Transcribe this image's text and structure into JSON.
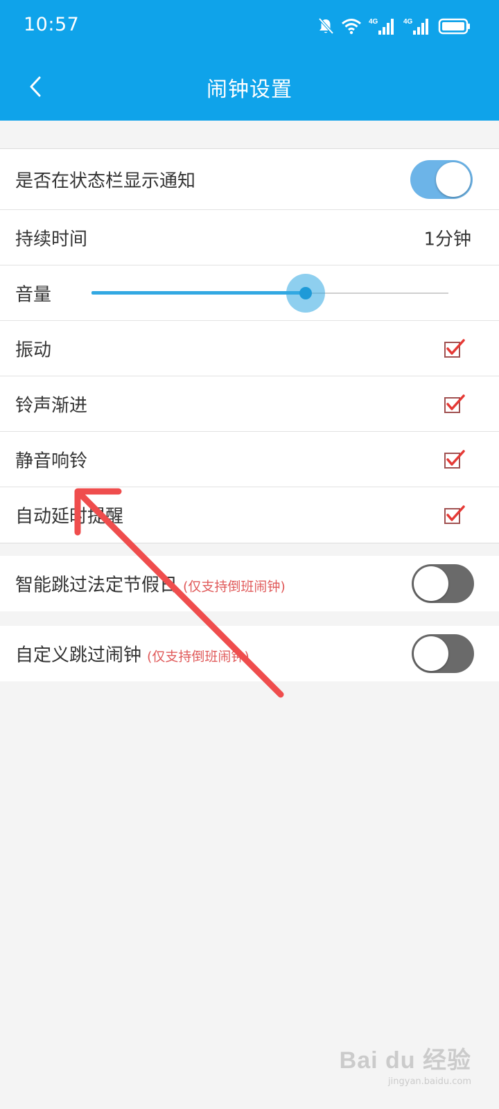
{
  "status_bar": {
    "time": "10:57",
    "icons": [
      "bell-muted-icon",
      "wifi-icon",
      "signal-4g-icon",
      "signal-4g-icon",
      "battery-icon"
    ],
    "network_label": "4G"
  },
  "header": {
    "title": "闹钟设置",
    "back_icon": "chevron-left-icon"
  },
  "settings": {
    "show_notification": {
      "label": "是否在状态栏显示通知",
      "enabled": true
    },
    "duration": {
      "label": "持续时间",
      "value": "1分钟"
    },
    "volume": {
      "label": "音量",
      "level_fraction": 0.6
    },
    "vibrate": {
      "label": "振动",
      "checked": true
    },
    "gradual_ring": {
      "label": "铃声渐进",
      "checked": true
    },
    "silent_ring": {
      "label": "静音响铃",
      "checked": true
    },
    "auto_snooze": {
      "label": "自动延时提醒",
      "checked": true
    }
  },
  "skip_options": {
    "skip_holidays": {
      "label": "智能跳过法定节假日",
      "note": "(仅支持倒班闹钟)",
      "enabled": false
    },
    "custom_skip": {
      "label": "自定义跳过闹钟",
      "note": "(仅支持倒班闹钟)",
      "enabled": false
    }
  },
  "watermark": {
    "logo": "Bai du 经验",
    "url": "jingyan.baidu.com"
  },
  "colors": {
    "primary": "#0fa3ea",
    "toggle_on": "#6cb4e8",
    "toggle_off": "#6a6a6a",
    "checkbox_check": "#e53935",
    "annotation_arrow": "#ef4d4d"
  }
}
